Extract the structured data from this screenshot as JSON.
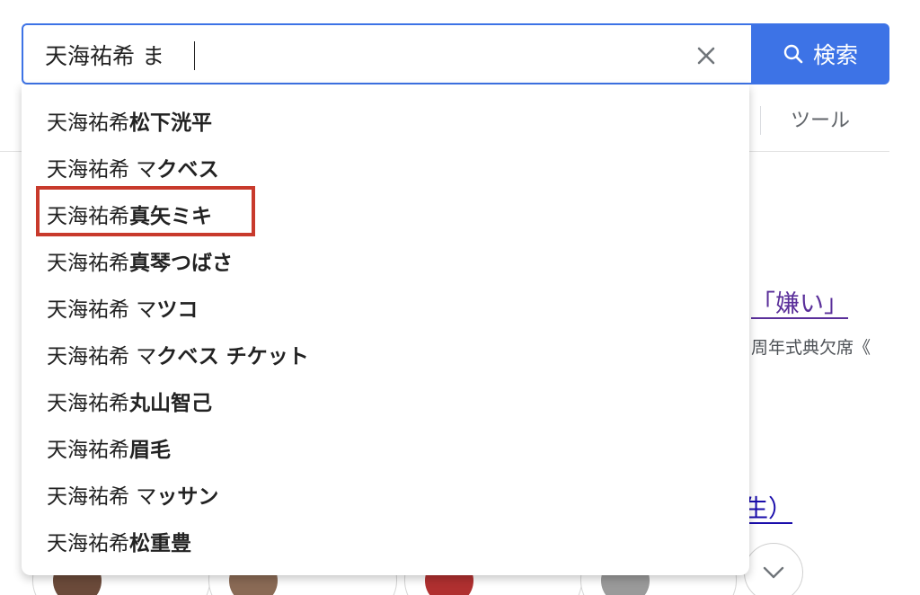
{
  "search": {
    "query": "天海祐希 ま",
    "button_label": "検索",
    "search_icon": "search-icon",
    "clear_icon": "close-icon"
  },
  "background": {
    "tools_label": "ツール",
    "result_link_1": "「嫌い」",
    "result_snippet": "周年式典欠席《",
    "result_link_2": "生）"
  },
  "suggestions": [
    {
      "prefix": "天海祐希 ",
      "suffix": "松下洸平"
    },
    {
      "prefix": "天海祐希 マ",
      "suffix": "クベス"
    },
    {
      "prefix": "天海祐希 ",
      "suffix": "真矢ミキ"
    },
    {
      "prefix": "天海祐希 ",
      "suffix": "真琴つばさ"
    },
    {
      "prefix": "天海祐希 マ",
      "suffix": "ツコ"
    },
    {
      "prefix": "天海祐希 マ",
      "suffix": "クベス チケット"
    },
    {
      "prefix": "天海祐希 ",
      "suffix": "丸山智己"
    },
    {
      "prefix": "天海祐希 ",
      "suffix": "眉毛"
    },
    {
      "prefix": "天海祐希 マ",
      "suffix": "ッサン"
    },
    {
      "prefix": "天海祐希 ",
      "suffix": "松重豊"
    }
  ],
  "colors": {
    "accent": "#3d73e6",
    "highlight": "#c83a2c"
  }
}
